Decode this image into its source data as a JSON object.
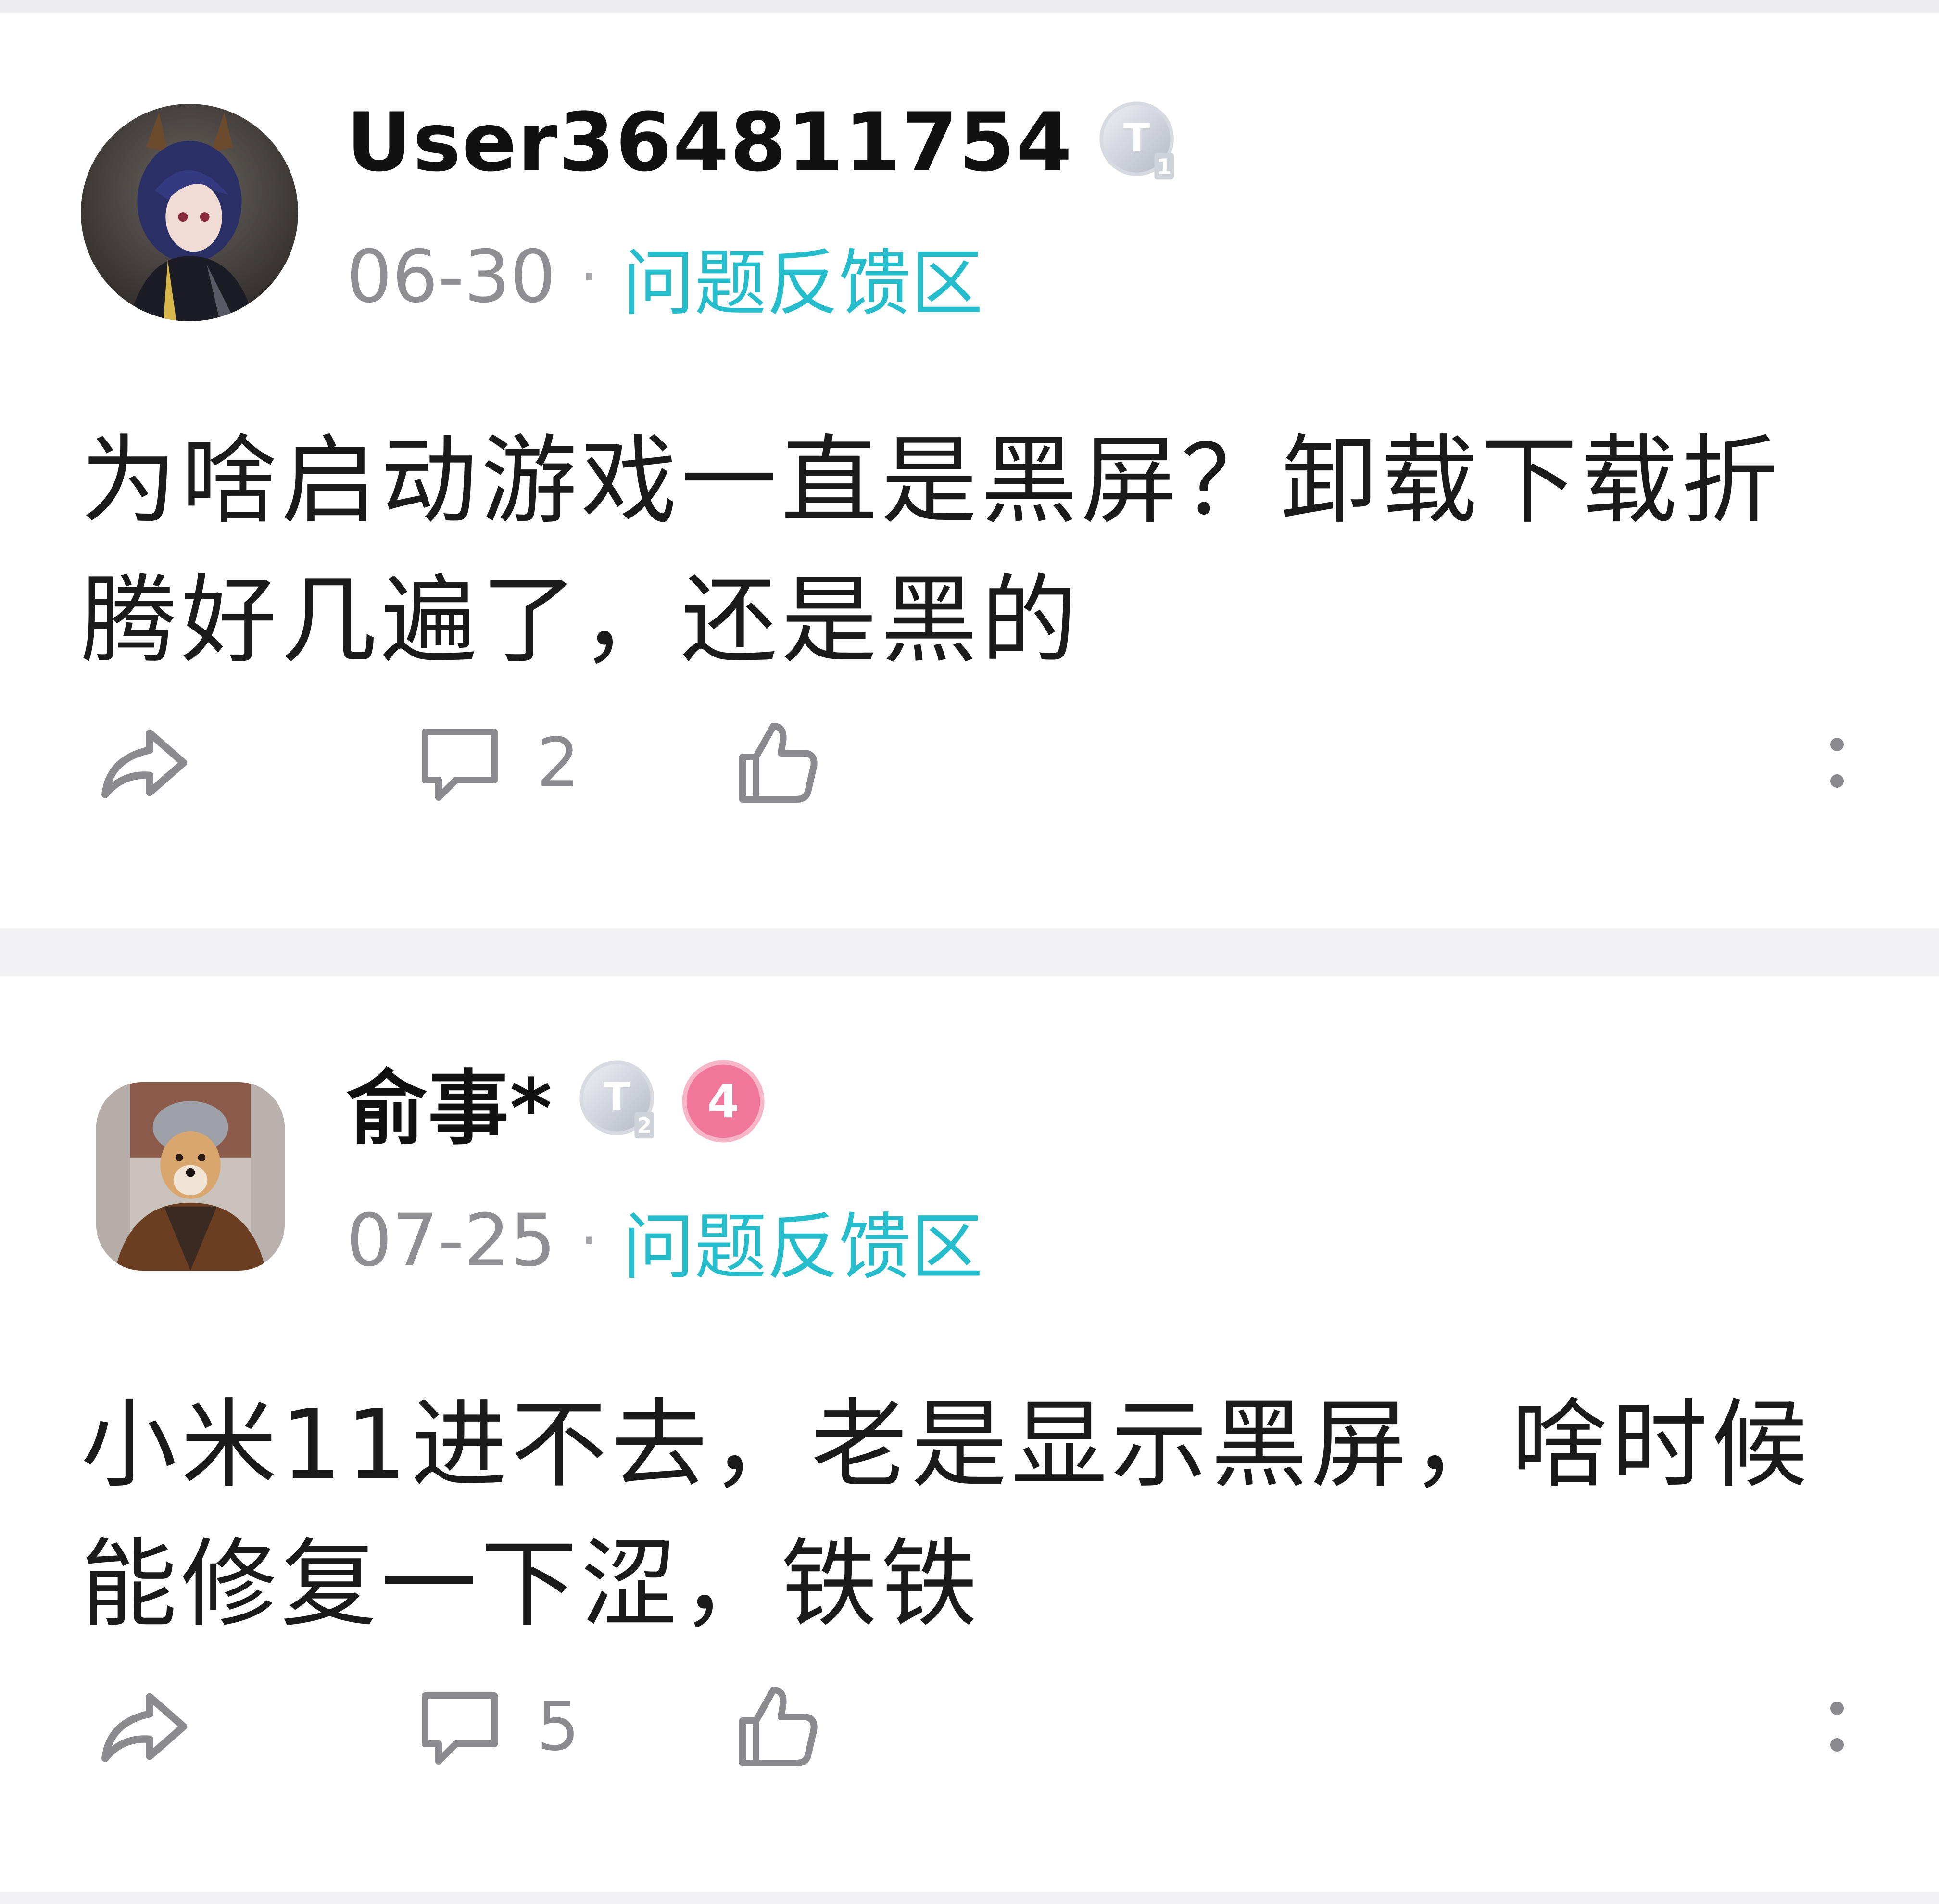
{
  "posts": [
    {
      "username": "User364811754",
      "level_badge": {
        "letter": "T",
        "sub": "1",
        "color": "#c5c9d2"
      },
      "date": "06-30",
      "separator": "·",
      "forum": "问题反馈区",
      "content": "为啥启动游戏一直是黑屏？卸载下载折腾好几遍了，还是黑的",
      "comments_count": "2",
      "avatar_icon": "anime-character-avatar"
    },
    {
      "username": "俞事*",
      "level_badge": {
        "letter": "T",
        "sub": "2",
        "color": "#c5c9d2"
      },
      "extra_badge": {
        "text": "4",
        "color": "#f0779a"
      },
      "date": "07-25",
      "separator": "·",
      "forum": "问题反馈区",
      "content": "小米11进不去，老是显示黑屏，啥时候能修复一下涩，铁铁",
      "comments_count": "5",
      "avatar_icon": "shiba-dog-avatar"
    }
  ],
  "colors": {
    "accent": "#25bdcb",
    "text_primary": "#111111",
    "text_secondary": "#8e8e93",
    "icon_gray": "#8a8a8f",
    "divider": "#f2f2f4"
  }
}
